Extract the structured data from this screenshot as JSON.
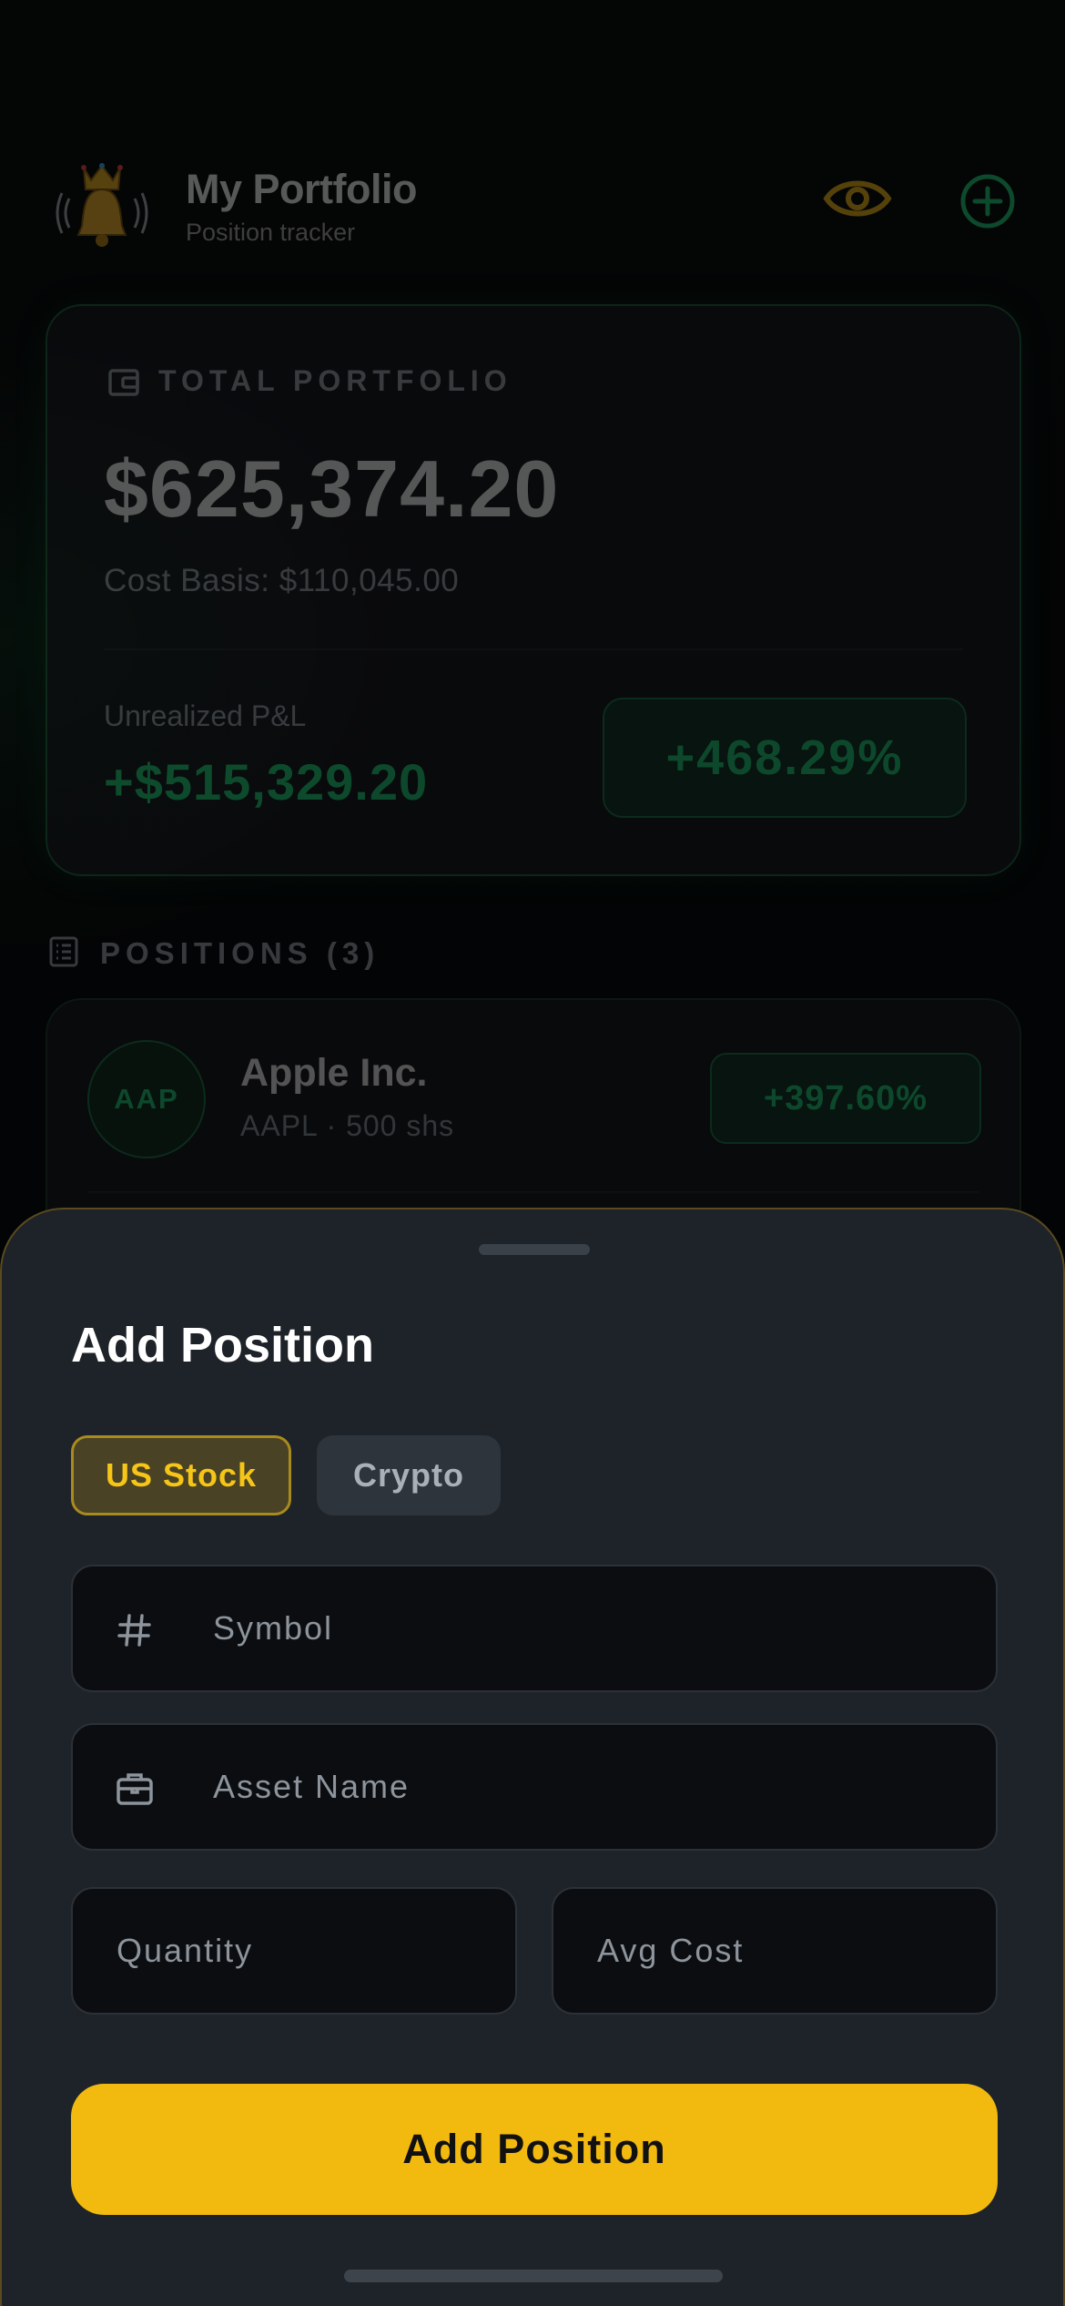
{
  "header": {
    "title": "My Portfolio",
    "subtitle": "Position tracker",
    "logo_icon": "crown-bell-logo",
    "visibility_icon": "eye-icon",
    "add_icon": "plus-circle-icon"
  },
  "total": {
    "label": "TOTAL PORTFOLIO",
    "value": "$625,374.20",
    "cost_basis": "Cost Basis: $110,045.00",
    "pl_label": "Unrealized P&L",
    "pl_value": "+$515,329.20",
    "pl_percent": "+468.29%"
  },
  "positions": {
    "header": "POSITIONS (3)",
    "items": [
      {
        "badge": "AAP",
        "name": "Apple Inc.",
        "meta": "AAPL  ·  500 shs",
        "percent": "+397.60%"
      }
    ]
  },
  "sheet": {
    "title": "Add Position",
    "types": [
      "US Stock",
      "Crypto"
    ],
    "selected_type": "US Stock",
    "symbol_placeholder": "Symbol",
    "name_placeholder": "Asset Name",
    "quantity_placeholder": "Quantity",
    "avg_cost_placeholder": "Avg Cost",
    "submit_label": "Add Position"
  },
  "colors": {
    "accent": "#f2b90f",
    "positive": "#1fb46a",
    "background": "#050607",
    "sheet": "#1e2329"
  }
}
